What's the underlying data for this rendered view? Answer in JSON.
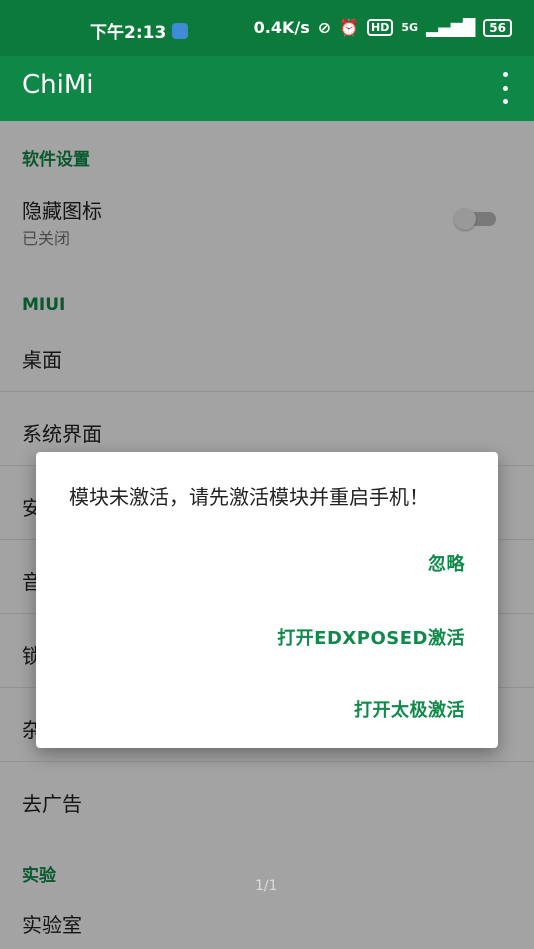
{
  "status_bar": {
    "time": "下午2:13",
    "network_speed": "0.4K/s",
    "battery": "56",
    "signal_label": "5G"
  },
  "app_bar": {
    "title": "ChiMi"
  },
  "settings": {
    "software_section": {
      "title": "软件设置",
      "hide_icon": {
        "label": "隐藏图标",
        "summary": "已关闭",
        "enabled": false
      }
    },
    "miui_section": {
      "title": "MIUI",
      "items": [
        "桌面",
        "系统界面",
        "安",
        "音",
        "锁",
        "杂"
      ]
    },
    "ads_item": "去广告",
    "experiment_section": {
      "title": "实验",
      "items": [
        "实验室"
      ]
    }
  },
  "dialog": {
    "message": "模块未激活，请先激活模块并重启手机！",
    "buttons": {
      "ignore": "忽略",
      "edxposed": "打开EDXPOSED激活",
      "taichi": "打开太极激活"
    }
  },
  "page_indicator": "1/1"
}
